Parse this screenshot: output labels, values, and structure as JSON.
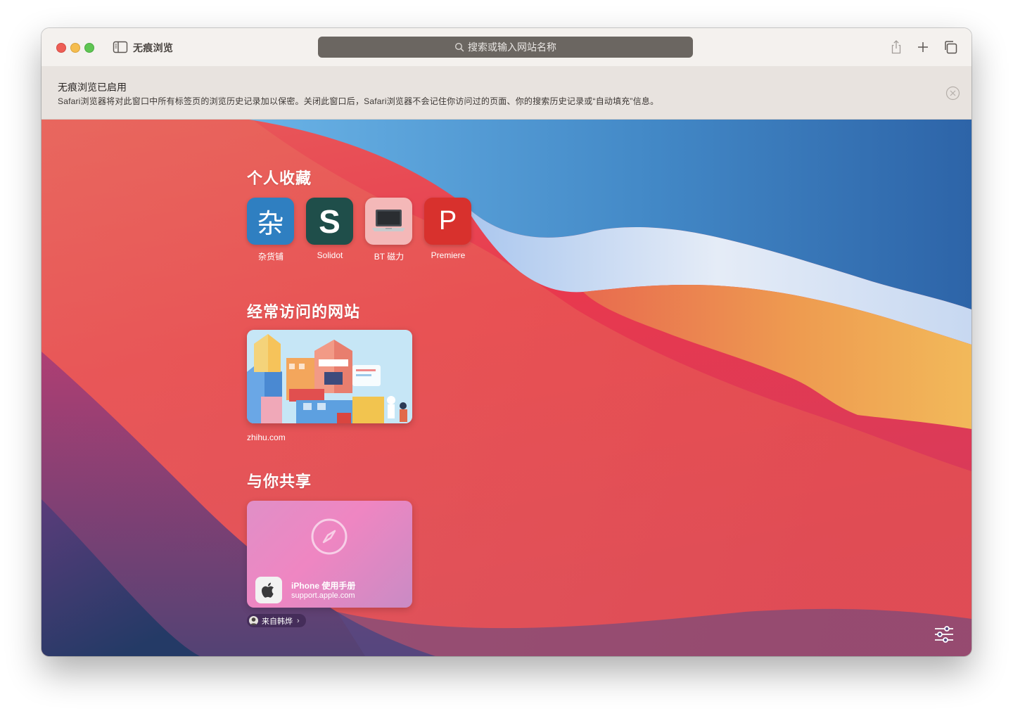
{
  "window": {
    "title": "无痕浏览",
    "address_placeholder": "搜索或输入网站名称",
    "icons": [
      "sidebar-icon",
      "search-icon",
      "share-icon",
      "plus-icon",
      "tabs-overview-icon"
    ]
  },
  "banner": {
    "title": "无痕浏览已启用",
    "text": "Safari浏览器将对此窗口中所有标签页的浏览历史记录加以保密。关闭此窗口后，Safari浏览器不会记住你访问过的页面、你的搜索历史记录或“自动填充”信息。"
  },
  "favorites": {
    "title": "个人收藏",
    "items": [
      {
        "label": "杂货铺",
        "glyph": "杂",
        "color": "#2f7fc1"
      },
      {
        "label": "Solidot",
        "glyph": "S",
        "color": "#1f4e4a"
      },
      {
        "label": "BT 磁力",
        "glyph": "laptop-icon",
        "color": "#f4b8b8"
      },
      {
        "label": "Premiere",
        "glyph": "P",
        "color": "#d8312d"
      }
    ]
  },
  "frequent": {
    "title": "经常访问的网站",
    "items": [
      {
        "label": "zhihu.com"
      }
    ]
  },
  "shared": {
    "title": "与你共享",
    "card_title": "iPhone 使用手册",
    "card_domain": "support.apple.com",
    "from": "来自韩烨",
    "chevron": "›"
  },
  "colors": {
    "toolbar_bg": "#f4f1ee",
    "banner_bg": "#e8e3df",
    "address_bg": "#6b6661"
  }
}
